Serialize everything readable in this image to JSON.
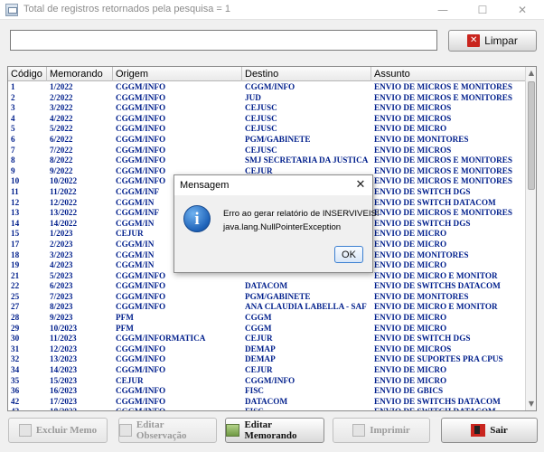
{
  "window": {
    "title": "Total de registros retornados pela pesquisa = 1",
    "minimize": "—",
    "maximize": "☐",
    "close": "✕"
  },
  "search": {
    "value": "",
    "placeholder": ""
  },
  "toolbar": {
    "limpar_label": "Limpar"
  },
  "table": {
    "columns": [
      "Código",
      "Memorando",
      "Origem",
      "Destino",
      "Assunto"
    ],
    "rows": [
      [
        "1",
        "1/2022",
        "CGGM/INFO",
        "CGGM/INFO",
        "ENVIO  DE MICROS E MONITORES"
      ],
      [
        "2",
        "2/2022",
        "CGGM/INFO",
        "JUD",
        "ENVIO  DE MICROS  E MONITORES"
      ],
      [
        "3",
        "3/2022",
        "CGGM/INFO",
        "CEJUSC",
        "ENVIO DE MICROS"
      ],
      [
        "4",
        "4/2022",
        "CGGM/INFO",
        "CEJUSC",
        "ENVIO DE MICROS"
      ],
      [
        "5",
        "5/2022",
        "CGGM/INFO",
        "CEJUSC",
        "ENVIO DE MICRO"
      ],
      [
        "6",
        "6/2022",
        "CGGM/INFO",
        "PGM/GABINETE",
        "ENVIO DE MONITORES"
      ],
      [
        "7",
        "7/2022",
        "CGGM/INFO",
        "CEJUSC",
        "ENVIO DE MICROS"
      ],
      [
        "8",
        "8/2022",
        "CGGM/INFO",
        "SMJ SECRETARIA DA JUSTICA",
        "ENVIO DE MICROS E MONITORES"
      ],
      [
        "9",
        "9/2022",
        "CGGM/INFO",
        "CEJUR",
        "ENVIO DE MICROS E MONITORES"
      ],
      [
        "10",
        "10/2022",
        "CGGM/INFO",
        "",
        "ENVIO DE MICROS E MONITORES"
      ],
      [
        "11",
        "11/2022",
        "CGGM/INF",
        "",
        "ENVIO DE SWITCH DGS"
      ],
      [
        "12",
        "12/2022",
        "CGGM/IN",
        "",
        "ENVIO DE SWITCH DATACOM"
      ],
      [
        "13",
        "13/2022",
        "CGGM/INF",
        "",
        "ENVIO DE MICROS E MONITORES"
      ],
      [
        "14",
        "14/2022",
        "CGGM/IN",
        "",
        "ENVIO DE SWITCH DGS"
      ],
      [
        "15",
        "1/2023",
        "CEJUR",
        "",
        "ENVIO DE MICRO"
      ],
      [
        "17",
        "2/2023",
        "CGGM/IN",
        "",
        "ENVIO DE MICRO"
      ],
      [
        "18",
        "3/2023",
        "CGGM/IN",
        "",
        "ENVIO DE MONITORES"
      ],
      [
        "19",
        "4/2023",
        "CGGM/IN",
        "",
        "ENVIO DE MICRO"
      ],
      [
        "21",
        "5/2023",
        "CGGM/INFO",
        "",
        "ENVIO DE MICRO E MONITOR"
      ],
      [
        "22",
        "6/2023",
        "CGGM/INFO",
        "DATACOM",
        "ENVIO DE SWITCHS DATACOM"
      ],
      [
        "25",
        "7/2023",
        "CGGM/INFO",
        "PGM/GABINETE",
        "ENVIO DE MONITORES"
      ],
      [
        "27",
        "8/2023",
        "CGGM/INFO",
        "ANA CLAUDIA LABELLA - SAF",
        "ENVIO DE MICRO E MONITOR"
      ],
      [
        "28",
        "9/2023",
        "PFM",
        "CGGM",
        "ENVIO DE MICRO"
      ],
      [
        "29",
        "10/2023",
        "PFM",
        "CGGM",
        "ENVIO DE MICRO"
      ],
      [
        "30",
        "11/2023",
        "CGGM/INFORMATICA",
        "CEJUR",
        "ENVIO DE SWITCH DGS"
      ],
      [
        "31",
        "12/2023",
        "CGGM/INFO",
        "DEMAP",
        "ENVIO DE MICROS"
      ],
      [
        "32",
        "13/2023",
        "CGGM/INFO",
        "DEMAP",
        "ENVIO DE SUPORTES PRA CPUS"
      ],
      [
        "34",
        "14/2023",
        "CGGM/INFO",
        "CEJUR",
        "ENVIO DE MICRO"
      ],
      [
        "35",
        "15/2023",
        "CEJUR",
        "CGGM/INFO",
        "ENVIO DE MICRO"
      ],
      [
        "36",
        "16/2023",
        "CGGM/INFO",
        "FISC",
        "ENVIO DE GBICS"
      ],
      [
        "42",
        "17/2023",
        "CGGM/INFO",
        "DATACOM",
        "ENVIO DE SWITCHS DATACOM"
      ],
      [
        "43",
        "18/2023",
        "CGGM/INFO",
        "FISC",
        "ENVIO DE SWITCH DATACOM"
      ]
    ]
  },
  "buttons": {
    "excluir": "Excluir Memo",
    "editar_obs": "Editar Observação",
    "editar_memo": "Editar Memorando",
    "imprimir": "Imprimir",
    "sair": "Sair"
  },
  "dialog": {
    "title": "Mensagem",
    "close": "✕",
    "line1": "Erro ao gerar relatório de INSERVIVEIS!",
    "line2": "java.lang.NullPointerException",
    "ok": "OK",
    "icon": "information-icon"
  },
  "colors": {
    "cell_text": "#001f8c",
    "limpar_icon": "#c9251e",
    "info_icon": "#1e62b8"
  }
}
